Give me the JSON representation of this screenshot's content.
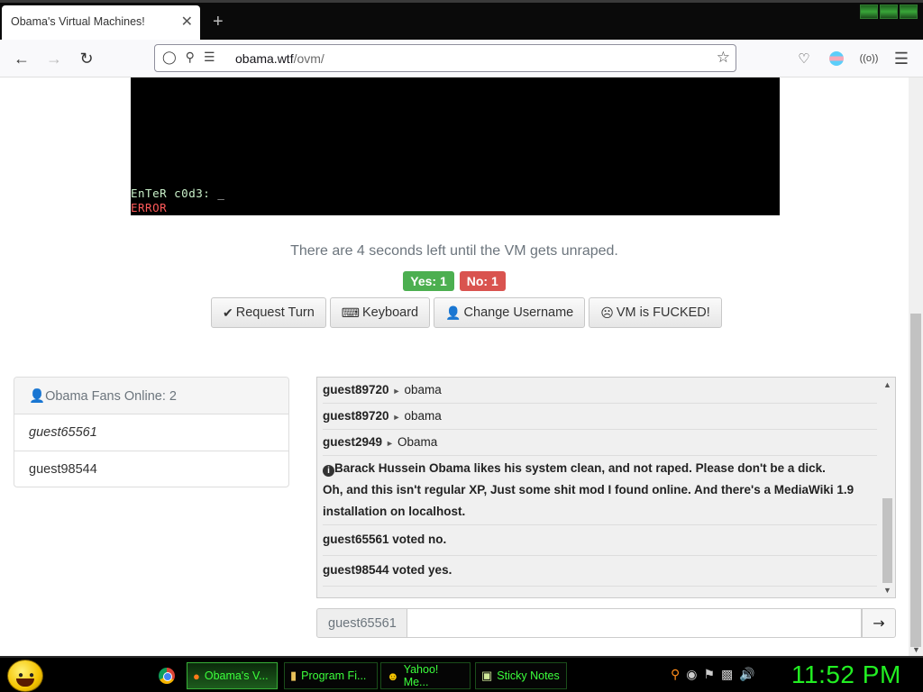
{
  "browser": {
    "tab_title": "Obama's Virtual Machines!",
    "tab_close": "✕",
    "new_tab": "+",
    "url_host": "obama.wtf",
    "url_path": "/ovm/"
  },
  "vm": {
    "prompt": "EnTeR c0d3: ",
    "cursor": "_",
    "error": "ERROR"
  },
  "reset_notice": "There are 4 seconds left until the VM gets unraped.",
  "votes": {
    "yes": "Yes: 1",
    "no": "No: 1"
  },
  "buttons": {
    "request_turn": "Request Turn",
    "keyboard": "Keyboard",
    "change_username": "Change Username",
    "vote_reset": "VM is FUCKED!"
  },
  "users": {
    "header": "Obama Fans Online: 2",
    "list": [
      "guest65561",
      "guest98544"
    ]
  },
  "chat": {
    "messages": [
      {
        "user": "guest89720",
        "text": "obama"
      },
      {
        "user": "guest89720",
        "text": "obama"
      },
      {
        "user": "guest2949",
        "text": "Obama"
      }
    ],
    "motd": "Barack Hussein Obama likes his system clean, and not raped. Please don't be a dick.",
    "motd2": "Oh, and this isn't regular XP, Just some shit mod I found online. And there's a MediaWiki 1.9 installation on localhost.",
    "vote1": "guest65561 voted no.",
    "vote2": "guest98544 voted yes.",
    "username": "guest65561",
    "input_value": "",
    "send": "→"
  },
  "taskbar": {
    "tasks": [
      {
        "label": "Obama's V...",
        "icon": "firefox-icon"
      },
      {
        "label": "Program Fi...",
        "icon": "folder-icon"
      },
      {
        "label": "Yahoo! Me...",
        "icon": "messenger-icon"
      },
      {
        "label": "Sticky Notes",
        "icon": "sticky-notes-icon"
      }
    ],
    "clock": "11:52 PM"
  },
  "colors": {
    "accent_green": "#22ee22",
    "vote_yes": "#4caf50",
    "vote_no": "#d9534f"
  }
}
